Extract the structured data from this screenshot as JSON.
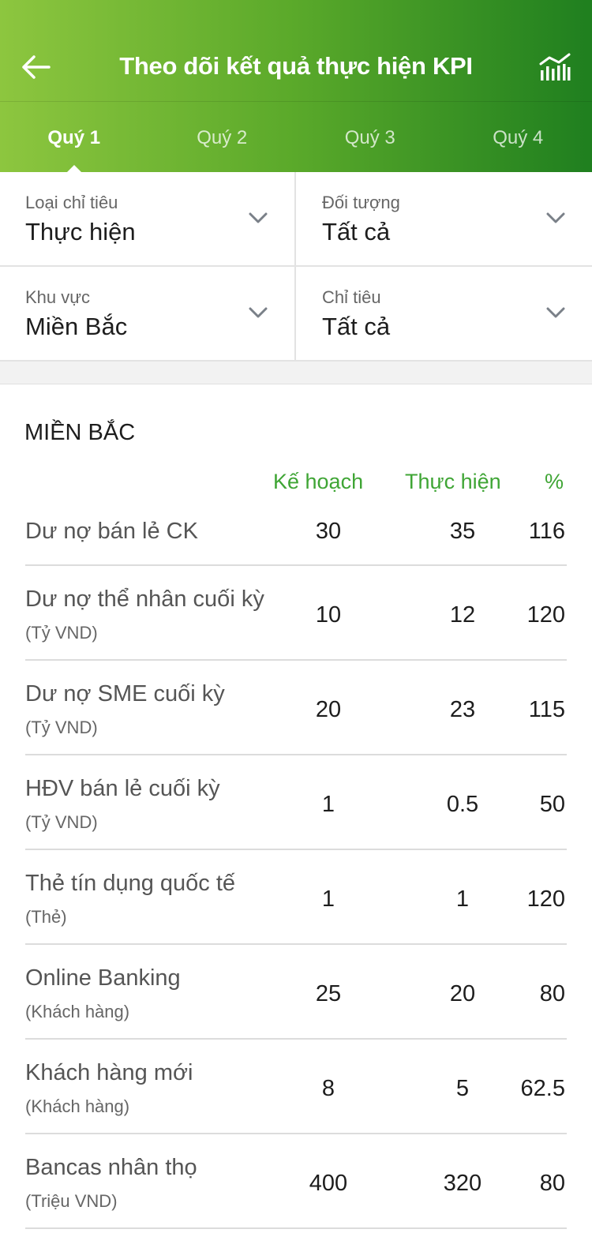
{
  "header": {
    "title": "Theo dõi kết quả thực hiện KPI",
    "back_icon": "arrow-left-icon",
    "chart_icon": "bar-chart-icon",
    "gradient_colors": [
      "#8dc63f",
      "#1f7f1f"
    ]
  },
  "tabs": [
    {
      "label": "Quý 1",
      "active": true
    },
    {
      "label": "Quý 2",
      "active": false
    },
    {
      "label": "Quý 3",
      "active": false
    },
    {
      "label": "Quý 4",
      "active": false
    }
  ],
  "filters": {
    "metric_type": {
      "label": "Loại chỉ tiêu",
      "value": "Thực hiện"
    },
    "target": {
      "label": "Đối tượng",
      "value": "Tất cả"
    },
    "region": {
      "label": "Khu vực",
      "value": "Miền Bắc"
    },
    "indicator": {
      "label": "Chỉ tiêu",
      "value": "Tất cả"
    }
  },
  "section": {
    "title": "MIỀN BẮC",
    "accent_color": "#3fa535",
    "columns": {
      "plan": "Kế hoạch",
      "actual": "Thực hiện",
      "percent": "%"
    },
    "rows": [
      {
        "name": "Dư nợ bán lẻ CK",
        "unit": "",
        "plan": "30",
        "actual": "35",
        "percent": "116"
      },
      {
        "name": "Dư nợ thể nhân cuối kỳ",
        "unit": "(Tỷ VND)",
        "plan": "10",
        "actual": "12",
        "percent": "120"
      },
      {
        "name": "Dư nợ SME cuối kỳ",
        "unit": "(Tỷ VND)",
        "plan": "20",
        "actual": "23",
        "percent": "115"
      },
      {
        "name": "HĐV bán lẻ cuối kỳ",
        "unit": "(Tỷ VND)",
        "plan": "1",
        "actual": "0.5",
        "percent": "50"
      },
      {
        "name": "Thẻ tín dụng quốc tế",
        "unit": "(Thẻ)",
        "plan": "1",
        "actual": "1",
        "percent": "120"
      },
      {
        "name": "Online Banking",
        "unit": "(Khách hàng)",
        "plan": "25",
        "actual": "20",
        "percent": "80"
      },
      {
        "name": "Khách hàng mới",
        "unit": "(Khách hàng)",
        "plan": "8",
        "actual": "5",
        "percent": "62.5"
      },
      {
        "name": "Bancas nhân thọ",
        "unit": "(Triệu VND)",
        "plan": "400",
        "actual": "320",
        "percent": "80"
      }
    ]
  }
}
